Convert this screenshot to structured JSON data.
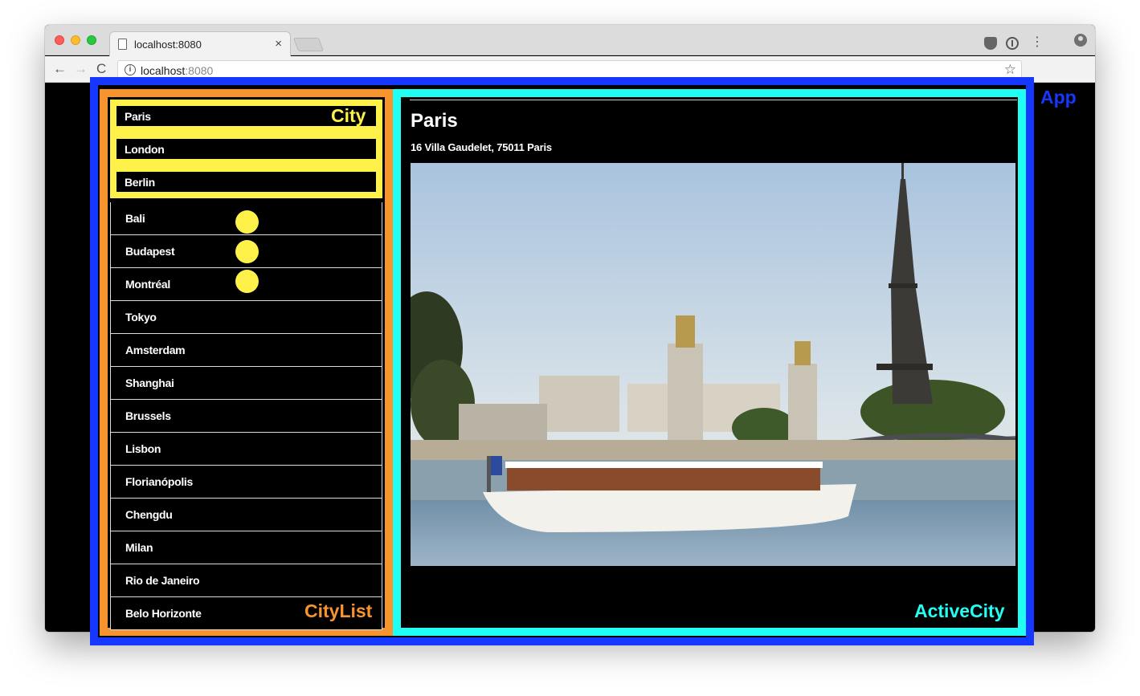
{
  "browser": {
    "tab_title": "localhost:8080",
    "tab_close": "×",
    "url_host": "localhost",
    "url_port": ":8080",
    "info_glyph": "i",
    "star_glyph": "☆",
    "back_glyph": "←",
    "forward_glyph": "→",
    "reload_glyph": "C",
    "menu_glyph": "⋮"
  },
  "labels": {
    "app": "App",
    "city": "City",
    "city_list": "CityList",
    "active_city": "ActiveCity"
  },
  "cities": [
    {
      "name": "Paris"
    },
    {
      "name": "London"
    },
    {
      "name": "Berlin"
    },
    {
      "name": "Bali"
    },
    {
      "name": "Budapest"
    },
    {
      "name": "Montréal"
    },
    {
      "name": "Tokyo"
    },
    {
      "name": "Amsterdam"
    },
    {
      "name": "Shanghai"
    },
    {
      "name": "Brussels"
    },
    {
      "name": "Lisbon"
    },
    {
      "name": "Florianópolis"
    },
    {
      "name": "Chengdu"
    },
    {
      "name": "Milan"
    },
    {
      "name": "Rio de Janeiro"
    },
    {
      "name": "Belo Horizonte"
    }
  ],
  "active_city": {
    "name": "Paris",
    "address": "16 Villa Gaudelet, 75011 Paris",
    "photo_description": "Eiffel Tower and Pont Alexandre III with river boat"
  },
  "colors": {
    "app": "#1537ff",
    "city_list": "#f7942e",
    "city": "#fef14a",
    "active_city": "#21fff5"
  }
}
